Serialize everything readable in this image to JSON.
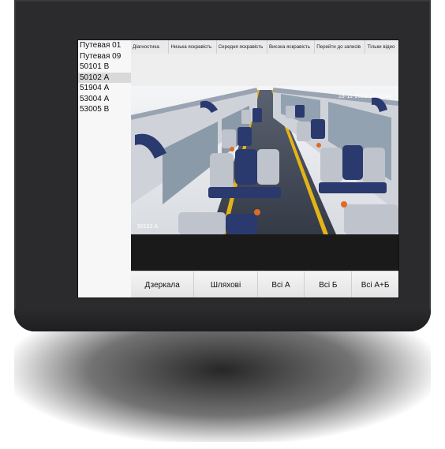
{
  "sidebar": {
    "items": [
      {
        "label": "Путевая 01",
        "selected": false
      },
      {
        "label": "Путевая 09",
        "selected": false
      },
      {
        "label": "50101 В",
        "selected": false
      },
      {
        "label": "50102 А",
        "selected": true
      },
      {
        "label": "51904 А",
        "selected": false
      },
      {
        "label": "53004 А",
        "selected": false
      },
      {
        "label": "53005 В",
        "selected": false
      }
    ]
  },
  "tabs": [
    {
      "label": "Діагностика"
    },
    {
      "label": "Низька яскравість"
    },
    {
      "label": "Середня яскравість"
    },
    {
      "label": "Висока яскравість"
    },
    {
      "label": "Перейти до записів"
    },
    {
      "label": "Тільки відео"
    }
  ],
  "video": {
    "timestamp": "16-11-2021 14:12:44",
    "camera_label": "50102 А"
  },
  "buttons": [
    {
      "label": "Дзеркала"
    },
    {
      "label": "Шляхові"
    },
    {
      "label": "Всі А"
    },
    {
      "label": "Всі Б"
    },
    {
      "label": "Всі А+Б"
    }
  ],
  "colors": {
    "device_frame": "#2b2b2d",
    "seat_blue": "#2a3a6e",
    "seat_grey": "#bfc3cc",
    "stripe_yellow": "#e3b417",
    "handle_orange": "#e06a2a"
  }
}
